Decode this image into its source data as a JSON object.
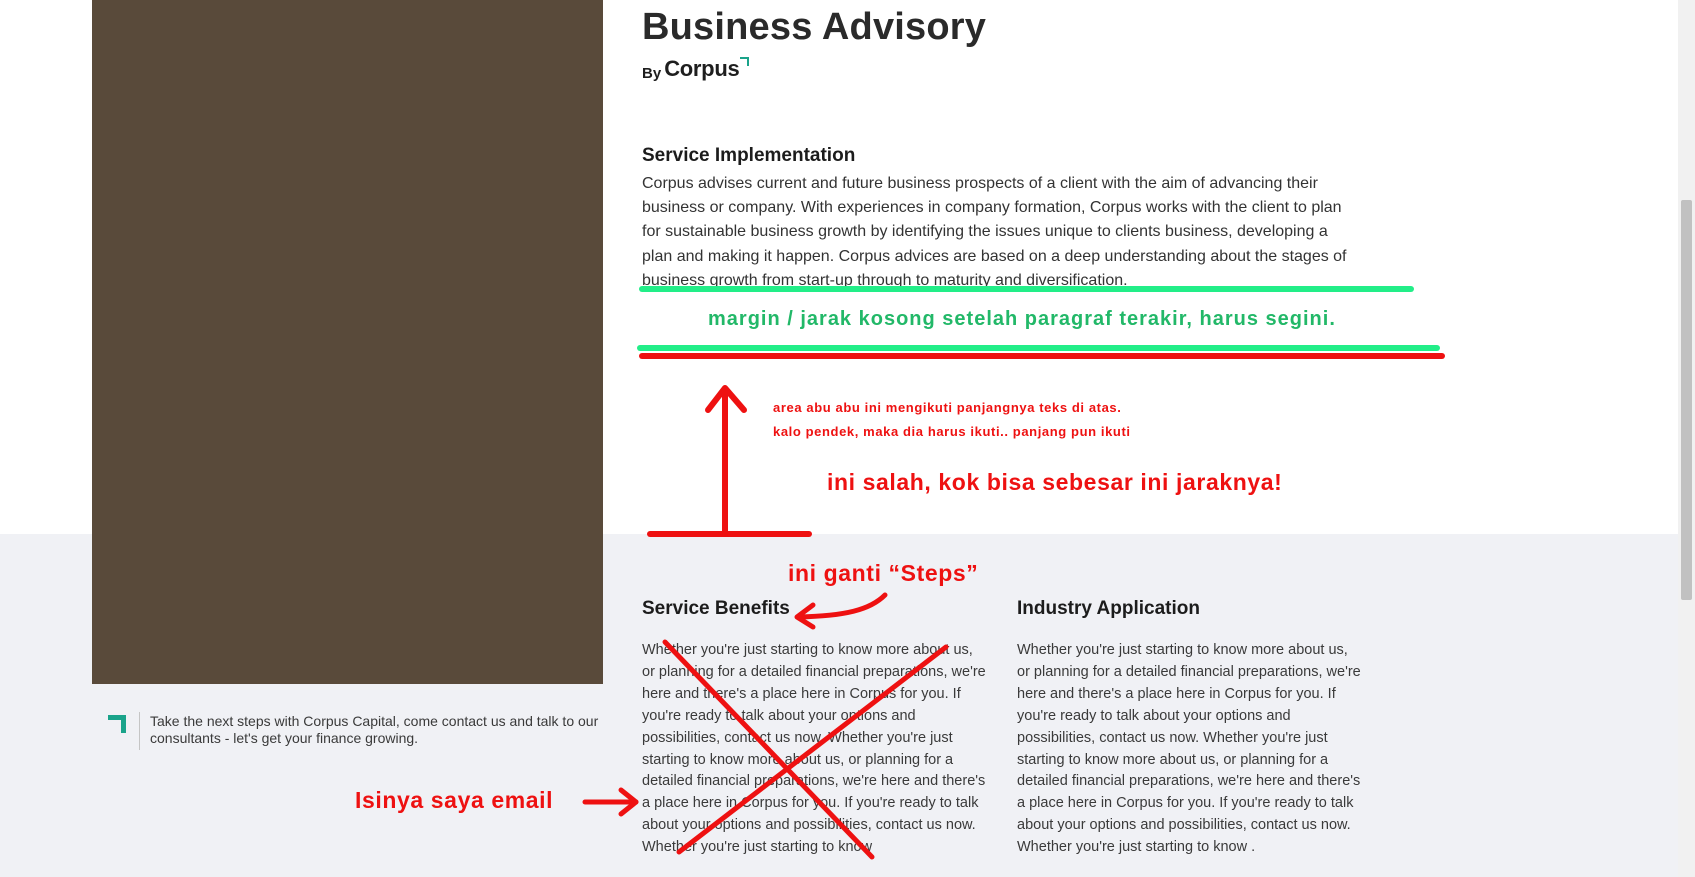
{
  "page": {
    "title": "Business Advisory",
    "byline_by": "By",
    "byline_brand": "Corpus"
  },
  "implementation": {
    "heading": "Service Implementation",
    "body": "Corpus advises current and future business prospects of a client with the aim of advancing their business or company. With experiences in company formation, Corpus works with the client to plan for sustainable business growth by identifying the issues unique to clients business, developing a plan and making it happen. Corpus advices are based on a deep understanding about the stages of business growth from start-up through to maturity and diversification."
  },
  "benefits": {
    "heading": "Service Benefits",
    "body": "Whether you're just starting to know more about us, or planning for a detailed financial preparations, we're here and there's a place here in Corpus for you. If you're ready to talk about your options and possibilities, contact us now. Whether you're just starting to know more about us, or planning for a detailed financial preparations, we're here and there's a place here in Corpus for you. If you're ready to talk about your options and possibilities, contact us now. Whether you're just starting to know"
  },
  "industry": {
    "heading": "Industry Application",
    "body": "Whether you're just starting to know more about us, or planning for a detailed financial preparations, we're here and there's a place here in Corpus for you. If you're ready to talk about your options and possibilities, contact us now. Whether you're just starting to know more about us, or planning for a detailed financial preparations, we're here and there's a place here in Corpus for you. If you're ready to talk about your options and possibilities, contact us now. Whether you're just starting to know ."
  },
  "cta": {
    "text": "Take the next steps with Corpus Capital, come contact us and talk to our consultants - let's get your finance growing."
  },
  "annotations": {
    "margin_note": "margin / jarak kosong setelah paragraf terakir, harus segini.",
    "gray_area_line1": "area abu abu ini mengikuti panjangnya teks di atas.",
    "gray_area_line2": "kalo pendek, maka dia harus ikuti.. panjang pun ikuti",
    "wrong_gap": "ini salah, kok bisa sebesar ini jaraknya!",
    "replace_steps": "ini ganti “Steps”",
    "email_note": "Isinya saya email",
    "green_color": "#22b868",
    "red_color": "#ee1111"
  },
  "colors": {
    "hero_image": "#594a3a",
    "gray_band": "#f0f1f5",
    "accent": "#1aa38a"
  }
}
